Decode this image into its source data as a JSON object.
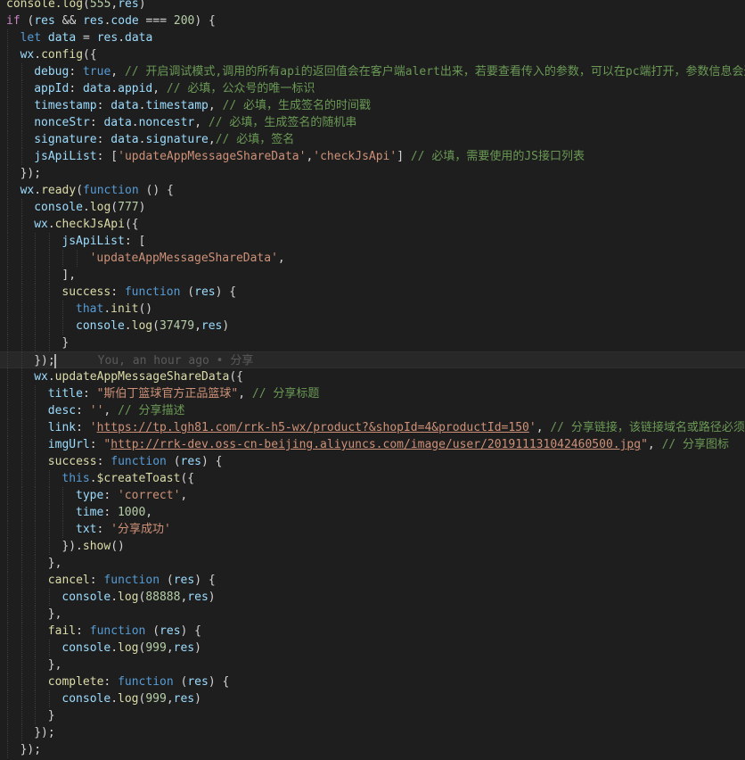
{
  "editor": {
    "theme_colors": {
      "background": "#1e1e1e",
      "keyword": "#569cd6",
      "control": "#c586c0",
      "variable": "#9cdcfe",
      "function": "#dcdcaa",
      "string": "#ce9178",
      "number": "#b5cea8",
      "comment": "#6a9955",
      "punctuation": "#d4d4d4"
    },
    "cursor_line_index": 21,
    "git_blame": "You, an hour ago • 分享",
    "lines": [
      {
        "indent": 0,
        "tokens": [
          [
            "fn",
            "console.log"
          ],
          [
            "p",
            "("
          ],
          [
            "num",
            "555"
          ],
          [
            "p",
            ","
          ],
          [
            "var",
            "res"
          ],
          [
            "p",
            ")"
          ]
        ]
      },
      {
        "indent": 0,
        "tokens": [
          [
            "ctl",
            "if"
          ],
          [
            "p",
            " ("
          ],
          [
            "var",
            "res"
          ],
          [
            "p",
            " && "
          ],
          [
            "var",
            "res"
          ],
          [
            "p",
            "."
          ],
          [
            "var",
            "code"
          ],
          [
            "p",
            " === "
          ],
          [
            "num",
            "200"
          ],
          [
            "p",
            ") {"
          ]
        ]
      },
      {
        "indent": 1,
        "tokens": [
          [
            "kw",
            "let"
          ],
          [
            "p",
            " "
          ],
          [
            "var",
            "data"
          ],
          [
            "p",
            " = "
          ],
          [
            "var",
            "res"
          ],
          [
            "p",
            "."
          ],
          [
            "var",
            "data"
          ]
        ]
      },
      {
        "indent": 1,
        "tokens": [
          [
            "var",
            "wx"
          ],
          [
            "p",
            "."
          ],
          [
            "fn",
            "config"
          ],
          [
            "p",
            "({"
          ]
        ]
      },
      {
        "indent": 2,
        "tokens": [
          [
            "var",
            "debug"
          ],
          [
            "p",
            ": "
          ],
          [
            "kw",
            "true"
          ],
          [
            "p",
            ", "
          ],
          [
            "cm",
            "// 开启调试模式,调用的所有api的返回值会在客户端alert出来，若要查看传入的参数，可以在pc端打开，参数信息会通过log打出，仅在pc端时才会打印。"
          ]
        ]
      },
      {
        "indent": 2,
        "tokens": [
          [
            "var",
            "appId"
          ],
          [
            "p",
            ": "
          ],
          [
            "var",
            "data"
          ],
          [
            "p",
            "."
          ],
          [
            "var",
            "appid"
          ],
          [
            "p",
            ", "
          ],
          [
            "cm",
            "// 必填，公众号的唯一标识"
          ]
        ]
      },
      {
        "indent": 2,
        "tokens": [
          [
            "var",
            "timestamp"
          ],
          [
            "p",
            ": "
          ],
          [
            "var",
            "data"
          ],
          [
            "p",
            "."
          ],
          [
            "var",
            "timestamp"
          ],
          [
            "p",
            ", "
          ],
          [
            "cm",
            "// 必填，生成签名的时间戳"
          ]
        ]
      },
      {
        "indent": 2,
        "tokens": [
          [
            "var",
            "nonceStr"
          ],
          [
            "p",
            ": "
          ],
          [
            "var",
            "data"
          ],
          [
            "p",
            "."
          ],
          [
            "var",
            "noncestr"
          ],
          [
            "p",
            ", "
          ],
          [
            "cm",
            "// 必填，生成签名的随机串"
          ]
        ]
      },
      {
        "indent": 2,
        "tokens": [
          [
            "var",
            "signature"
          ],
          [
            "p",
            ": "
          ],
          [
            "var",
            "data"
          ],
          [
            "p",
            "."
          ],
          [
            "var",
            "signature"
          ],
          [
            "p",
            ","
          ],
          [
            "cm",
            "// 必填，签名"
          ]
        ]
      },
      {
        "indent": 2,
        "tokens": [
          [
            "var",
            "jsApiList"
          ],
          [
            "p",
            ": ["
          ],
          [
            "str",
            "'updateAppMessageShareData'"
          ],
          [
            "p",
            ","
          ],
          [
            "str",
            "'checkJsApi'"
          ],
          [
            "p",
            "] "
          ],
          [
            "cm",
            "// 必填，需要使用的JS接口列表"
          ]
        ]
      },
      {
        "indent": 1,
        "tokens": [
          [
            "p",
            "});"
          ]
        ]
      },
      {
        "indent": 1,
        "tokens": [
          [
            "var",
            "wx"
          ],
          [
            "p",
            "."
          ],
          [
            "fn",
            "ready"
          ],
          [
            "p",
            "("
          ],
          [
            "kw",
            "function"
          ],
          [
            "p",
            " () {"
          ]
        ]
      },
      {
        "indent": 2,
        "tokens": [
          [
            "var",
            "console"
          ],
          [
            "p",
            "."
          ],
          [
            "fn",
            "log"
          ],
          [
            "p",
            "("
          ],
          [
            "num",
            "777"
          ],
          [
            "p",
            ")"
          ]
        ]
      },
      {
        "indent": 2,
        "tokens": [
          [
            "var",
            "wx"
          ],
          [
            "p",
            "."
          ],
          [
            "fn",
            "checkJsApi"
          ],
          [
            "p",
            "({"
          ]
        ]
      },
      {
        "indent": 4,
        "tokens": [
          [
            "var",
            "jsApiList"
          ],
          [
            "p",
            ": ["
          ]
        ]
      },
      {
        "indent": 6,
        "tokens": [
          [
            "str",
            "'updateAppMessageShareData'"
          ],
          [
            "p",
            ","
          ]
        ]
      },
      {
        "indent": 4,
        "tokens": [
          [
            "p",
            "],"
          ]
        ]
      },
      {
        "indent": 4,
        "tokens": [
          [
            "fn",
            "success"
          ],
          [
            "p",
            ": "
          ],
          [
            "kw",
            "function"
          ],
          [
            "p",
            " ("
          ],
          [
            "var",
            "res"
          ],
          [
            "p",
            ") {"
          ]
        ]
      },
      {
        "indent": 5,
        "tokens": [
          [
            "kw",
            "that"
          ],
          [
            "p",
            "."
          ],
          [
            "fn",
            "init"
          ],
          [
            "p",
            "()"
          ]
        ]
      },
      {
        "indent": 5,
        "tokens": [
          [
            "var",
            "console"
          ],
          [
            "p",
            "."
          ],
          [
            "fn",
            "log"
          ],
          [
            "p",
            "("
          ],
          [
            "num",
            "37479"
          ],
          [
            "p",
            ","
          ],
          [
            "var",
            "res"
          ],
          [
            "p",
            ")"
          ]
        ]
      },
      {
        "indent": 4,
        "tokens": [
          [
            "p",
            "}"
          ]
        ]
      },
      {
        "indent": 2,
        "tokens": [
          [
            "p",
            "});"
          ]
        ]
      },
      {
        "indent": 2,
        "tokens": [
          [
            "var",
            "wx"
          ],
          [
            "p",
            "."
          ],
          [
            "fn",
            "updateAppMessageShareData"
          ],
          [
            "p",
            "({"
          ]
        ]
      },
      {
        "indent": 3,
        "tokens": [
          [
            "var",
            "title"
          ],
          [
            "p",
            ": "
          ],
          [
            "str",
            "\"斯伯丁篮球官方正品篮球\""
          ],
          [
            "p",
            ", "
          ],
          [
            "cm",
            "// 分享标题"
          ]
        ]
      },
      {
        "indent": 3,
        "tokens": [
          [
            "var",
            "desc"
          ],
          [
            "p",
            ": "
          ],
          [
            "str",
            "''"
          ],
          [
            "p",
            ", "
          ],
          [
            "cm",
            "// 分享描述"
          ]
        ]
      },
      {
        "indent": 3,
        "tokens": [
          [
            "var",
            "link"
          ],
          [
            "p",
            ": "
          ],
          [
            "str",
            "'"
          ],
          [
            "url",
            "https://tp.lgh81.com/rrk-h5-wx/product?&shopId=4&productId=150"
          ],
          [
            "str",
            "'"
          ],
          [
            "p",
            ", "
          ],
          [
            "cm",
            "// 分享链接，该链接域名或路径必须与当前页面对应的公众号JS安全域名一致"
          ]
        ]
      },
      {
        "indent": 3,
        "tokens": [
          [
            "var",
            "imgUrl"
          ],
          [
            "p",
            ": "
          ],
          [
            "str",
            "\""
          ],
          [
            "url",
            "http://rrk-dev.oss-cn-beijing.aliyuncs.com/image/user/201911131042460500.jpg"
          ],
          [
            "str",
            "\""
          ],
          [
            "p",
            ", "
          ],
          [
            "cm",
            "// 分享图标"
          ]
        ]
      },
      {
        "indent": 3,
        "tokens": [
          [
            "fn",
            "success"
          ],
          [
            "p",
            ": "
          ],
          [
            "kw",
            "function"
          ],
          [
            "p",
            " ("
          ],
          [
            "var",
            "res"
          ],
          [
            "p",
            ") {"
          ]
        ]
      },
      {
        "indent": 4,
        "tokens": [
          [
            "kw",
            "this"
          ],
          [
            "p",
            "."
          ],
          [
            "fn",
            "$createToast"
          ],
          [
            "p",
            "({"
          ]
        ]
      },
      {
        "indent": 5,
        "tokens": [
          [
            "var",
            "type"
          ],
          [
            "p",
            ": "
          ],
          [
            "str",
            "'correct'"
          ],
          [
            "p",
            ","
          ]
        ]
      },
      {
        "indent": 5,
        "tokens": [
          [
            "var",
            "time"
          ],
          [
            "p",
            ": "
          ],
          [
            "num",
            "1000"
          ],
          [
            "p",
            ","
          ]
        ]
      },
      {
        "indent": 5,
        "tokens": [
          [
            "var",
            "txt"
          ],
          [
            "p",
            ": "
          ],
          [
            "str",
            "'分享成功'"
          ]
        ]
      },
      {
        "indent": 4,
        "tokens": [
          [
            "p",
            "})."
          ],
          [
            "fn",
            "show"
          ],
          [
            "p",
            "()"
          ]
        ]
      },
      {
        "indent": 3,
        "tokens": [
          [
            "p",
            "},"
          ]
        ]
      },
      {
        "indent": 3,
        "tokens": [
          [
            "fn",
            "cancel"
          ],
          [
            "p",
            ": "
          ],
          [
            "kw",
            "function"
          ],
          [
            "p",
            " ("
          ],
          [
            "var",
            "res"
          ],
          [
            "p",
            ") {"
          ]
        ]
      },
      {
        "indent": 4,
        "tokens": [
          [
            "var",
            "console"
          ],
          [
            "p",
            "."
          ],
          [
            "fn",
            "log"
          ],
          [
            "p",
            "("
          ],
          [
            "num",
            "88888"
          ],
          [
            "p",
            ","
          ],
          [
            "var",
            "res"
          ],
          [
            "p",
            ")"
          ]
        ]
      },
      {
        "indent": 3,
        "tokens": [
          [
            "p",
            "},"
          ]
        ]
      },
      {
        "indent": 3,
        "tokens": [
          [
            "fn",
            "fail"
          ],
          [
            "p",
            ": "
          ],
          [
            "kw",
            "function"
          ],
          [
            "p",
            " ("
          ],
          [
            "var",
            "res"
          ],
          [
            "p",
            ") {"
          ]
        ]
      },
      {
        "indent": 4,
        "tokens": [
          [
            "var",
            "console"
          ],
          [
            "p",
            "."
          ],
          [
            "fn",
            "log"
          ],
          [
            "p",
            "("
          ],
          [
            "num",
            "999"
          ],
          [
            "p",
            ","
          ],
          [
            "var",
            "res"
          ],
          [
            "p",
            ")"
          ]
        ]
      },
      {
        "indent": 3,
        "tokens": [
          [
            "p",
            "},"
          ]
        ]
      },
      {
        "indent": 3,
        "tokens": [
          [
            "fn",
            "complete"
          ],
          [
            "p",
            ": "
          ],
          [
            "kw",
            "function"
          ],
          [
            "p",
            " ("
          ],
          [
            "var",
            "res"
          ],
          [
            "p",
            ") {"
          ]
        ]
      },
      {
        "indent": 4,
        "tokens": [
          [
            "var",
            "console"
          ],
          [
            "p",
            "."
          ],
          [
            "fn",
            "log"
          ],
          [
            "p",
            "("
          ],
          [
            "num",
            "999"
          ],
          [
            "p",
            ","
          ],
          [
            "var",
            "res"
          ],
          [
            "p",
            ")"
          ]
        ]
      },
      {
        "indent": 3,
        "tokens": [
          [
            "p",
            "}"
          ]
        ]
      },
      {
        "indent": 2,
        "tokens": [
          [
            "p",
            "});"
          ]
        ]
      },
      {
        "indent": 1,
        "tokens": [
          [
            "p",
            "});"
          ]
        ]
      }
    ]
  }
}
